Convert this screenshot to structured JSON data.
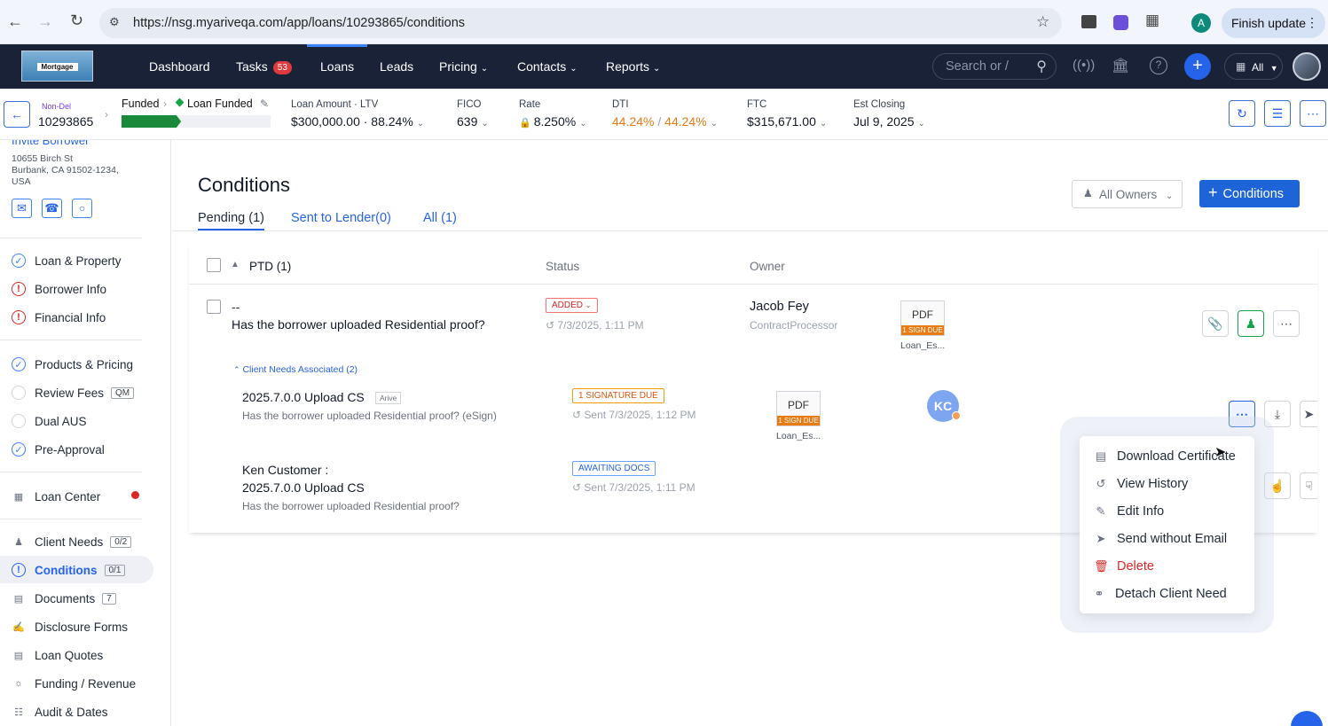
{
  "browser": {
    "url": "https://nsg.myariveqa.com/app/loans/10293865/conditions",
    "profile_initial": "A",
    "finish_update": "Finish update"
  },
  "nav": {
    "logo_text": "Mortgage",
    "items": [
      {
        "label": "Dashboard"
      },
      {
        "label": "Tasks",
        "badge": "53"
      },
      {
        "label": "Loans"
      },
      {
        "label": "Leads"
      },
      {
        "label": "Pricing"
      },
      {
        "label": "Contacts"
      },
      {
        "label": "Reports"
      }
    ],
    "search_placeholder": "Search or /",
    "all_label": "All"
  },
  "loan": {
    "tag": "Non-Del",
    "number": "10293865",
    "stage1": "Funded",
    "stage2": "Loan Funded",
    "progress_fraction": 0.4,
    "amount_label": "Loan Amount · LTV",
    "amount_value": "$300,000.00 · 88.24%",
    "fico_label": "FICO",
    "fico_value": "639",
    "rate_label": "Rate",
    "rate_value": "8.250%",
    "dti_label": "DTI",
    "dti_value1": "44.24%",
    "dti_sep": " / ",
    "dti_value2": "44.24%",
    "ftc_label": "FTC",
    "ftc_value": "$315,671.00",
    "closing_label": "Est Closing",
    "closing_value": "Jul 9, 2025"
  },
  "sidebar": {
    "partial_title": "Invite Borrower",
    "address1": "10655 Birch St",
    "address2": "Burbank, CA 91502-1234,",
    "address3": "USA",
    "items": [
      {
        "label": "Loan & Property"
      },
      {
        "label": "Borrower Info"
      },
      {
        "label": "Financial Info"
      },
      {
        "label": "Products & Pricing"
      },
      {
        "label": "Review Fees",
        "count": "QM"
      },
      {
        "label": "Dual AUS"
      },
      {
        "label": "Pre-Approval"
      },
      {
        "label": "Loan Center"
      },
      {
        "label": "Client Needs",
        "count": "0/2"
      },
      {
        "label": "Conditions",
        "count": "0/1"
      },
      {
        "label": "Documents",
        "count": "7"
      },
      {
        "label": "Disclosure Forms"
      },
      {
        "label": "Loan Quotes"
      },
      {
        "label": "Funding / Revenue"
      },
      {
        "label": "Audit & Dates"
      }
    ]
  },
  "page": {
    "title": "Conditions",
    "owners_filter": "All Owners",
    "add_button": "Conditions",
    "tabs": [
      {
        "label": "Pending (1)"
      },
      {
        "label": "Sent to Lender(0)"
      },
      {
        "label": "All (1)"
      }
    ],
    "group_label": "PTD (1)",
    "col_status": "Status",
    "col_owner": "Owner"
  },
  "condition": {
    "prefix": "--",
    "text": "Has the borrower uploaded Residential proof?",
    "status": "ADDED",
    "date": "7/3/2025, 1:11 PM",
    "owner_name": "Jacob Fey",
    "owner_role": "ContractProcessor",
    "doc_type": "PDF",
    "doc_due": "1 SIGN DUE",
    "doc_name": "Loan_Es..."
  },
  "client_needs": {
    "header": "Client Needs Associated (2)",
    "items": [
      {
        "title": "2025.7.0.0 Upload CS",
        "tag": "Arive",
        "subtitle": "Has the borrower uploaded Residential proof? (eSign)",
        "status": "1 SIGNATURE DUE",
        "date": "Sent 7/3/2025, 1:12 PM",
        "doc_type": "PDF",
        "doc_due": "1 SIGN DUE",
        "doc_name": "Loan_Es...",
        "avatar": "KC"
      },
      {
        "title_line1": "Ken Customer :",
        "title": "2025.7.0.0 Upload CS",
        "subtitle": "Has the borrower uploaded Residential proof?",
        "status": "AWAITING DOCS",
        "date": "Sent 7/3/2025, 1:11 PM"
      }
    ]
  },
  "context_menu": {
    "items": [
      {
        "label": "Download Certificate"
      },
      {
        "label": "View History"
      },
      {
        "label": "Edit Info"
      },
      {
        "label": "Send without Email"
      },
      {
        "label": "Delete"
      },
      {
        "label": "Detach Client Need"
      }
    ]
  },
  "colors": {
    "nav_bg": "#1a2238",
    "accent": "#2563eb",
    "success": "#16a34a",
    "warning": "#ea7a12",
    "danger": "#dc2626"
  }
}
